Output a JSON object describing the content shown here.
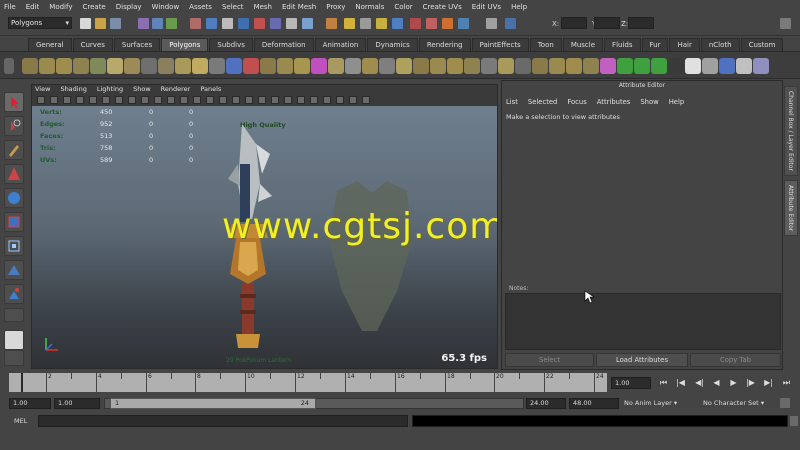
{
  "menubar": [
    "File",
    "Edit",
    "Modify",
    "Create",
    "Display",
    "Window",
    "Assets",
    "Select",
    "Mesh",
    "Edit Mesh",
    "Proxy",
    "Normals",
    "Color",
    "Create UVs",
    "Edit UVs",
    "Help"
  ],
  "status": {
    "mode": "Polygons",
    "coord_labels": [
      "X:",
      "Y:",
      "Z:"
    ]
  },
  "shelf_tabs": [
    "General",
    "Curves",
    "Surfaces",
    "Polygons",
    "Subdivs",
    "Deformation",
    "Animation",
    "Dynamics",
    "Rendering",
    "PaintEffects",
    "Toon",
    "Muscle",
    "Fluids",
    "Fur",
    "Hair",
    "nCloth",
    "Custom"
  ],
  "shelf_active": "Polygons",
  "panel_menu": [
    "View",
    "Shading",
    "Lighting",
    "Show",
    "Renderer",
    "Panels"
  ],
  "hud": {
    "rows": [
      {
        "label": "Verts:",
        "v1": "450",
        "v2": "0",
        "v3": "0"
      },
      {
        "label": "Edges:",
        "v1": "952",
        "v2": "0",
        "v3": "0"
      },
      {
        "label": "Faces:",
        "v1": "513",
        "v2": "0",
        "v3": "0"
      },
      {
        "label": "Tris:",
        "v1": "758",
        "v2": "0",
        "v3": "0"
      },
      {
        "label": "UVs:",
        "v1": "589",
        "v2": "0",
        "v3": "0"
      }
    ],
    "quality": "High Quality",
    "fps": "65.3 fps",
    "caption": "20 PokPokum Lantern"
  },
  "watermark": "www.cgtsj.com",
  "attribute_editor": {
    "title": "Attribute Editor",
    "menu": [
      "List",
      "Selected",
      "Focus",
      "Attributes",
      "Show",
      "Help"
    ],
    "message": "Make a selection to view attributes",
    "notes_label": "Notes:",
    "buttons": {
      "select": "Select",
      "load": "Load Attributes",
      "copy": "Copy Tab"
    }
  },
  "side_tabs": {
    "channel_box": "Channel Box / Layer Editor",
    "attribute_editor": "Attribute Editor"
  },
  "timeline": {
    "ticks": [
      "2",
      "4",
      "6",
      "8",
      "10",
      "12",
      "14",
      "16",
      "18",
      "20",
      "22",
      "24"
    ],
    "current_frame": "1.00"
  },
  "range": {
    "start": "1.00",
    "playback_start": "1.00",
    "handle_start": "1",
    "handle_end": "24",
    "playback_end": "24.00",
    "end": "48.00",
    "anim_layer": "No Anim Layer",
    "character_set": "No Character Set"
  },
  "command": {
    "label": "MEL"
  },
  "colors": {
    "watermark": "#f2ef22",
    "hud_label": "#1f5a2d",
    "viewport_top": "#6f7f8e",
    "viewport_bottom": "#2f3236"
  }
}
